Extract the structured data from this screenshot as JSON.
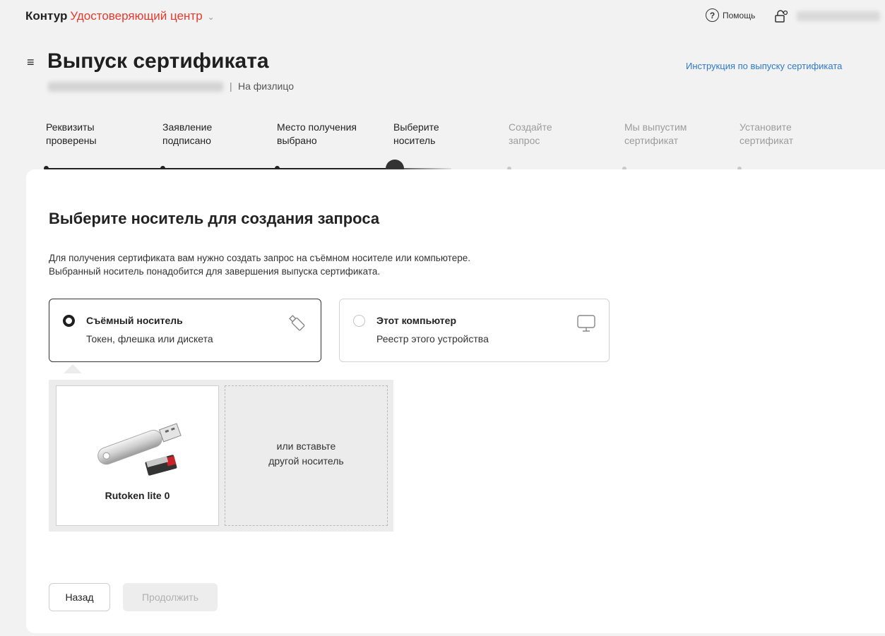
{
  "header": {
    "brand": "Контур",
    "product": "Удостоверяющий центр",
    "help_label": "Помощь"
  },
  "page": {
    "title": "Выпуск сертификата",
    "separator": "|",
    "subtitle": "На физлицо",
    "instruction_link": "Инструкция по выпуску сертификата"
  },
  "steps": [
    {
      "line1": "Реквизиты",
      "line2": "проверены",
      "state": "done"
    },
    {
      "line1": "Заявление",
      "line2": "подписано",
      "state": "done"
    },
    {
      "line1": "Место получения",
      "line2": "выбрано",
      "state": "done"
    },
    {
      "line1": "Выберите",
      "line2": "носитель",
      "state": "current"
    },
    {
      "line1": "Создайте",
      "line2": "запрос",
      "state": "pending"
    },
    {
      "line1": "Мы выпустим",
      "line2": "сертификат",
      "state": "pending"
    },
    {
      "line1": "Установите",
      "line2": "сертификат",
      "state": "pending"
    }
  ],
  "main": {
    "title": "Выберите носитель для создания запроса",
    "desc_line1": "Для получения сертификата вам нужно создать запрос на съёмном носителе или компьютере.",
    "desc_line2": "Выбранный носитель понадобится для завершения выпуска сертификата.",
    "options": [
      {
        "title": "Съёмный носитель",
        "subtitle": "Токен, флешка или дискета",
        "selected": true,
        "icon": "usb-stick-icon"
      },
      {
        "title": "Этот компьютер",
        "subtitle": "Реестр этого устройства",
        "selected": false,
        "icon": "monitor-icon"
      }
    ],
    "device_name": "Rutoken lite 0",
    "insert_line1": "или вставьте",
    "insert_line2": "другой носитель"
  },
  "buttons": {
    "back": "Назад",
    "next": "Продолжить"
  },
  "colors": {
    "brand_red": "#e63a2e",
    "link_blue": "#2e7ad1",
    "page_bg": "#f2f2f2",
    "devices_bg": "#ececec"
  }
}
